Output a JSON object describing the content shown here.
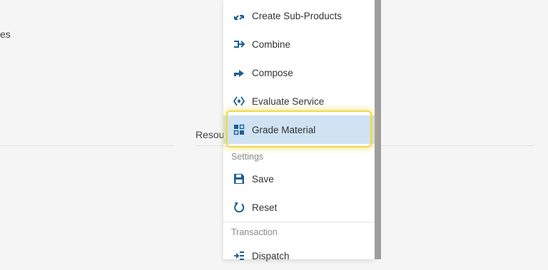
{
  "background": {
    "left_fragment": "es",
    "right_heading": "Resou"
  },
  "menu": {
    "items_top": [
      {
        "label": "Create Sub-Products",
        "icon": "create-sub-products-icon"
      },
      {
        "label": "Combine",
        "icon": "combine-icon"
      },
      {
        "label": "Compose",
        "icon": "compose-icon"
      },
      {
        "label": "Evaluate Service",
        "icon": "evaluate-service-icon"
      },
      {
        "label": "Grade Material",
        "icon": "grade-material-icon",
        "selected": true
      }
    ],
    "settings_section": {
      "title": "Settings",
      "items": [
        {
          "label": "Save",
          "icon": "save-icon"
        },
        {
          "label": "Reset",
          "icon": "reset-icon"
        }
      ]
    },
    "transaction_section": {
      "title": "Transaction",
      "items": [
        {
          "label": "Dispatch",
          "icon": "dispatch-icon"
        }
      ]
    }
  },
  "colors": {
    "icon_blue": "#1c5e96",
    "selected_bg": "#cfe3f3",
    "highlight_border": "#f1d84a"
  }
}
